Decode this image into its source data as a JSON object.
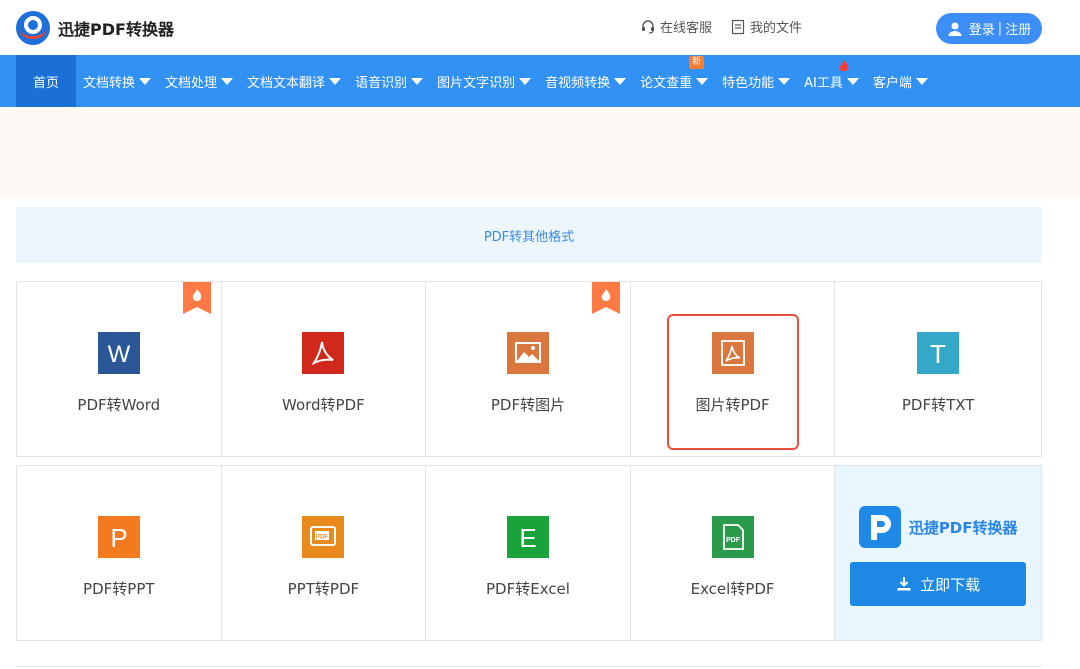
{
  "header": {
    "brand_name": "迅捷PDF转换器",
    "links": [
      {
        "label": "在线客服",
        "icon": "headset-icon"
      },
      {
        "label": "我的文件",
        "icon": "document-icon"
      }
    ],
    "login_label": "登录",
    "register_label": "注册",
    "user_icon": "user-icon"
  },
  "nav": {
    "items": [
      {
        "label": "首页",
        "active": true
      },
      {
        "label": "文档转换"
      },
      {
        "label": "文档处理"
      },
      {
        "label": "文档文本翻译"
      },
      {
        "label": "语音识别"
      },
      {
        "label": "图片文字识别"
      },
      {
        "label": "音视频转换"
      },
      {
        "label": "论文查重",
        "badge": "新"
      },
      {
        "label": "特色功能"
      },
      {
        "label": "AI工具",
        "badge_icon": "flame-icon"
      },
      {
        "label": "客户端"
      }
    ]
  },
  "section": {
    "title": "PDF转其他格式"
  },
  "tools": {
    "row1": [
      {
        "label": "PDF转Word",
        "icon": "word-icon",
        "hot": true
      },
      {
        "label": "Word转PDF",
        "icon": "acrobat-icon"
      },
      {
        "label": "PDF转图片",
        "icon": "image-icon",
        "hot": true
      },
      {
        "label": "图片转PDF",
        "icon": "acrobat-icon",
        "selected": true
      },
      {
        "label": "PDF转TXT",
        "icon": "text-icon"
      }
    ],
    "row2": [
      {
        "label": "PDF转PPT",
        "icon": "powerpoint-icon"
      },
      {
        "label": "PPT转PDF",
        "icon": "pdf-slide-icon"
      },
      {
        "label": "PDF转Excel",
        "icon": "excel-icon"
      },
      {
        "label": "Excel转PDF",
        "icon": "pdf-file-icon"
      }
    ]
  },
  "promo": {
    "brand_name": "迅捷PDF转换器",
    "download_label": "立即下载",
    "download_icon": "download-icon"
  },
  "colors": {
    "nav_bg": "#3192f4",
    "nav_active": "#1a70d6",
    "accent": "#3d8ef7",
    "selected_border": "#e6503c"
  }
}
